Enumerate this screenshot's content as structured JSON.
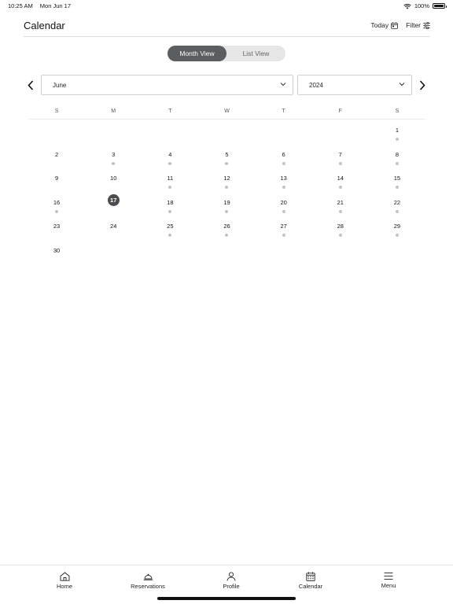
{
  "status": {
    "time": "10:25 AM",
    "date": "Mon Jun 17",
    "battery": "100%",
    "battery_level": 1.0
  },
  "header": {
    "title": "Calendar",
    "today_label": "Today",
    "filter_label": "Filter"
  },
  "view_toggle": {
    "month": "Month View",
    "list": "List View",
    "active": "month"
  },
  "picker": {
    "month": "June",
    "year": "2024"
  },
  "weekdays": [
    "S",
    "M",
    "T",
    "W",
    "T",
    "F",
    "S"
  ],
  "calendar": {
    "leading_blanks": 6,
    "today": 17,
    "days": [
      {
        "d": "1",
        "dot": true
      },
      {
        "d": "2",
        "dot": false
      },
      {
        "d": "3",
        "dot": true
      },
      {
        "d": "4",
        "dot": true
      },
      {
        "d": "5",
        "dot": true
      },
      {
        "d": "6",
        "dot": true
      },
      {
        "d": "7",
        "dot": true
      },
      {
        "d": "8",
        "dot": true
      },
      {
        "d": "9",
        "dot": false
      },
      {
        "d": "10",
        "dot": false
      },
      {
        "d": "11",
        "dot": true
      },
      {
        "d": "12",
        "dot": true
      },
      {
        "d": "13",
        "dot": true
      },
      {
        "d": "14",
        "dot": true
      },
      {
        "d": "15",
        "dot": true
      },
      {
        "d": "16",
        "dot": true
      },
      {
        "d": "17",
        "dot": false
      },
      {
        "d": "18",
        "dot": true
      },
      {
        "d": "19",
        "dot": true
      },
      {
        "d": "20",
        "dot": true
      },
      {
        "d": "21",
        "dot": true
      },
      {
        "d": "22",
        "dot": true
      },
      {
        "d": "23",
        "dot": false
      },
      {
        "d": "24",
        "dot": false
      },
      {
        "d": "25",
        "dot": true
      },
      {
        "d": "26",
        "dot": true
      },
      {
        "d": "27",
        "dot": true
      },
      {
        "d": "28",
        "dot": true
      },
      {
        "d": "29",
        "dot": true
      },
      {
        "d": "30",
        "dot": false
      }
    ]
  },
  "tabs": [
    {
      "label": "Home",
      "icon": "home-icon"
    },
    {
      "label": "Reservations",
      "icon": "cloche-icon"
    },
    {
      "label": "Profile",
      "icon": "person-icon"
    },
    {
      "label": "Calendar",
      "icon": "calendar-icon"
    },
    {
      "label": "Menu",
      "icon": "hamburger-icon"
    }
  ],
  "colors": {
    "accent": "#5b5e61",
    "today_circle": "#4a4c4f",
    "dot": "#c4c4c4"
  }
}
